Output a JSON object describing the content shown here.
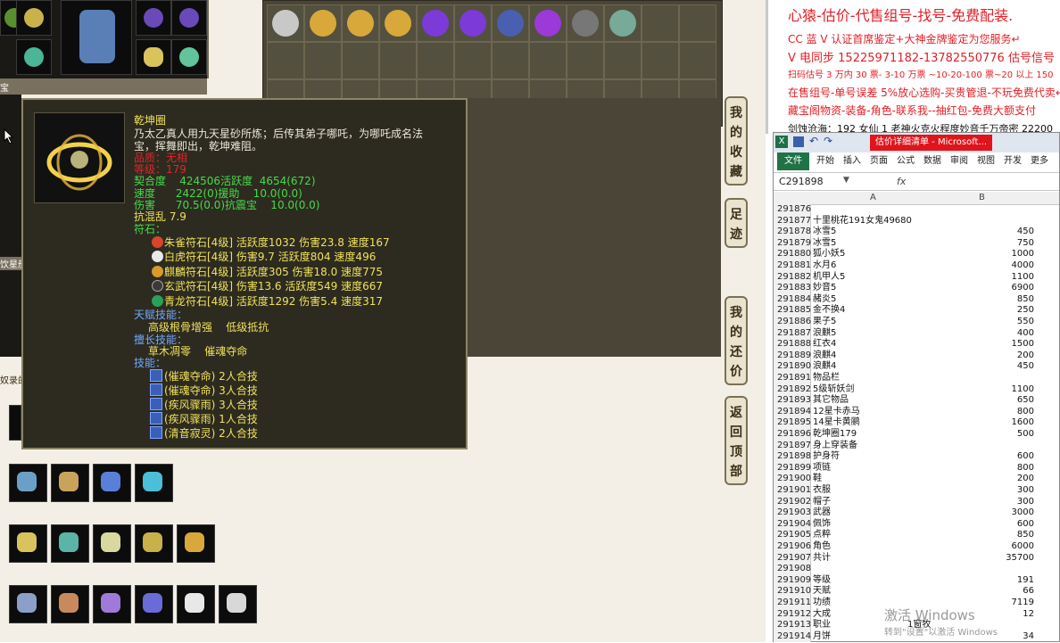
{
  "tooltip": {
    "name": "乾坤圈",
    "desc1": "乃太乙真人用九天星砂所炼；后传其弟子哪吒，为哪吒成名法",
    "desc2": "宝，挥舞即出，乾坤难阻。",
    "quality": "品质：无相",
    "level": "等级：179",
    "stat1": "契合度    424506活跃度  4654(672)",
    "stat2": "速度      2422(0)援助    10.0(0.0)",
    "stat3": "伤害      70.5(0.0)抗震宝    10.0(0.0)",
    "stat4": "抗混乱 7.9",
    "runes_title": "符石：",
    "runes": [
      "朱雀符石[4级] 活跃度1032 伤害23.8 速度167",
      "白虎符石[4级] 伤害9.7 活跃度804 速度496",
      "麒麟符石[4级] 活跃度305 伤害18.0 速度775",
      "玄武符石[4级] 伤害13.6 活跃度549 速度667",
      "青龙符石[4级] 活跃度1292 伤害5.4 速度317"
    ],
    "talent_title": "天赋技能：",
    "talent": "高级根骨增强    低级抵抗",
    "special_title": "擅长技能：",
    "special": "草木凋零    催魂夺命",
    "skills_title": "技能：",
    "skills": [
      "(催魂夺命) 2人合技",
      "(催魂夺命) 3人合技",
      "(疾风骤雨) 3人合技",
      "(疾风骤雨) 1人合技",
      "(清音寂灵) 2人合技"
    ]
  },
  "side_buttons": [
    {
      "chars": [
        "我",
        "的",
        "收",
        "藏"
      ]
    },
    {
      "chars": [
        "足",
        "迹"
      ]
    },
    {
      "chars": [
        "我",
        "的",
        "还",
        "价"
      ]
    },
    {
      "chars": [
        "返",
        "回",
        "顶",
        "部"
      ]
    }
  ],
  "left_labels": {
    "label_a": "宝",
    "label_b": "饮星册",
    "label_c": "奴录的"
  },
  "notepad": {
    "lines": [
      "心猿-估价-代售组号-找号-免费配装.",
      "CC 蓝 V 认证首席鉴定+大神金牌鉴定为您服务↵",
      "V 电同步 15225971182-13782550776 估号信号",
      "扫码估号 3 万内 30 票- 3-10 万票 ~10-20-100 票~20 以上 150",
      "在售组号-单号误差 5%放心选购-买贵管退-不玩免费代卖↵",
      "藏宝阁物资-装备-角色-联系我--抽红包-免费大额支付",
      "剑蚀沧海：192 女仙 1 老神火克火程度妙音千万帝密 22200"
    ]
  },
  "excel": {
    "title": "估价详细清单 - Microsoft...",
    "tabs": [
      "文件",
      "开始",
      "插入",
      "页面",
      "公式",
      "数据",
      "审阅",
      "视图",
      "开发",
      "更多"
    ],
    "cellref": "C291898",
    "fx": "fx",
    "col_a": "A",
    "col_b": "B",
    "rows": [
      [
        "291876",
        "",
        ""
      ],
      [
        "291877",
        "十里桃花191女鬼49680",
        ""
      ],
      [
        "291878",
        "冰雪5",
        "450"
      ],
      [
        "291879",
        "冰雪5",
        "750"
      ],
      [
        "291880",
        "狐小妖5",
        "1000"
      ],
      [
        "291881",
        "水月6",
        "4000"
      ],
      [
        "291882",
        "机甲人5",
        "1100"
      ],
      [
        "291883",
        "妙音5",
        "6900"
      ],
      [
        "291884",
        "赭炎5",
        "850"
      ],
      [
        "291885",
        "金不换4",
        "250"
      ],
      [
        "291886",
        "果子5",
        "550"
      ],
      [
        "291887",
        "浪麒5",
        "400"
      ],
      [
        "291888",
        "红衣4",
        "1500"
      ],
      [
        "291889",
        "浪麒4",
        "200"
      ],
      [
        "291890",
        "浪麒4",
        "450"
      ],
      [
        "291891",
        "物品栏",
        ""
      ],
      [
        "291892",
        "5级斩妖剑",
        "1100"
      ],
      [
        "291893",
        "其它物品",
        "650"
      ],
      [
        "291894",
        "12星卡赤马",
        "800"
      ],
      [
        "291895",
        "14星卡黄鹂",
        "1600"
      ],
      [
        "291896",
        "乾坤圈179",
        "500"
      ],
      [
        "291897",
        "身上穿装备",
        ""
      ],
      [
        "291898",
        "护身符",
        "600"
      ],
      [
        "291899",
        "项链",
        "800"
      ],
      [
        "291900",
        "鞋",
        "200"
      ],
      [
        "291901",
        "衣服",
        "300"
      ],
      [
        "291902",
        "帽子",
        "300"
      ],
      [
        "291903",
        "武器",
        "3000"
      ],
      [
        "291904",
        "佩饰",
        "600"
      ],
      [
        "291905",
        "点粹",
        "850"
      ],
      [
        "291906",
        "角色",
        "6000"
      ],
      [
        "291907",
        "共计",
        "35700"
      ],
      [
        "291908",
        "",
        ""
      ],
      [
        "291909",
        "等级",
        "191"
      ],
      [
        "291910",
        "天赋",
        "66"
      ],
      [
        "291911",
        "功绩",
        "7119"
      ],
      [
        "291912",
        "大成",
        "12"
      ],
      [
        "291913",
        "职业",
        "1窗牧"
      ],
      [
        "291914",
        "月饼",
        "34"
      ]
    ]
  },
  "watermark": {
    "line1": "激活 Windows",
    "line2": "转到\"设置\"以激活 Windows"
  },
  "colors": {
    "tooltip_bg": "#2d2b20",
    "green": "#48d94a",
    "red": "#e0262b",
    "yellow": "#f0e15a",
    "excel_green": "#217346"
  }
}
